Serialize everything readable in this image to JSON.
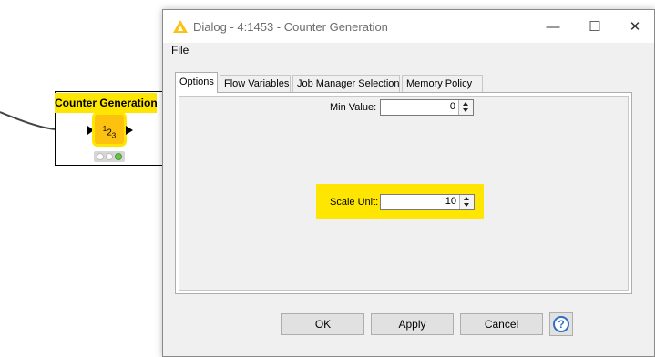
{
  "node": {
    "title": "Counter Generation",
    "icon_text": "123",
    "status": "executed"
  },
  "dialog": {
    "title": "Dialog - 4:1453 - Counter Generation",
    "menu": [
      "File"
    ],
    "window_controls": {
      "minimize": "—",
      "maximize": "☐",
      "close": "✕"
    },
    "tabs": [
      {
        "label": "Options",
        "active": true
      },
      {
        "label": "Flow Variables",
        "active": false
      },
      {
        "label": "Job Manager Selection",
        "active": false
      },
      {
        "label": "Memory Policy",
        "active": false
      }
    ],
    "fields": {
      "min_value": {
        "label": "Min Value:",
        "value": "0"
      },
      "scale_unit": {
        "label": "Scale Unit:",
        "value": "10"
      }
    },
    "buttons": {
      "ok": "OK",
      "apply": "Apply",
      "cancel": "Cancel",
      "help": "?"
    }
  },
  "colors": {
    "highlight": "#ffe600",
    "node_icon": "#fdc10f",
    "help_blue": "#2c6fc4"
  }
}
